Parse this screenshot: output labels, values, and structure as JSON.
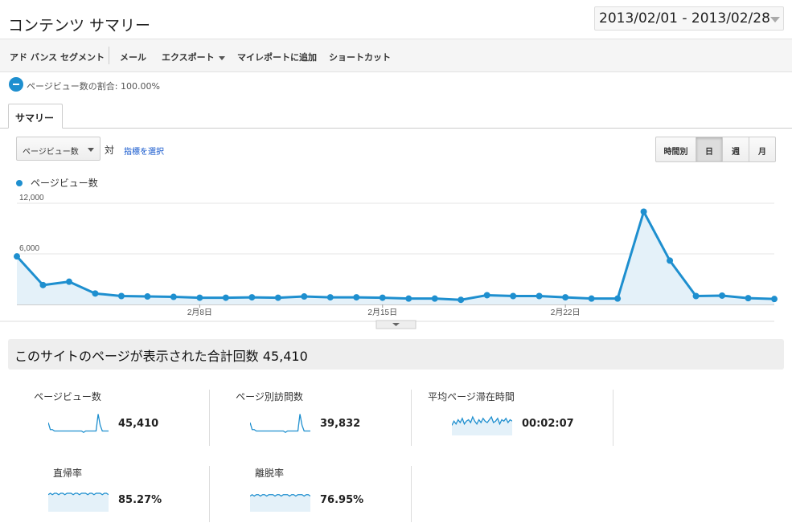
{
  "page": {
    "title": "コンテンツ サマリー"
  },
  "date_range": {
    "label": "2013/02/01 - 2013/02/28"
  },
  "toolbar": {
    "advanced_segments": "アド バンス セグメント",
    "email": "メール",
    "export": "エクスポート",
    "add_to_dashboard": "マイレポートに追加",
    "shortcut": "ショートカット"
  },
  "segment": {
    "label": "ページビュー数の割合: 100.00%"
  },
  "tabs": {
    "summary": "サマリー"
  },
  "controls": {
    "metric": "ページビュー数",
    "vs": "対",
    "choose_metric": "指標を選択",
    "periods": [
      "時間別",
      "日",
      "週",
      "月"
    ],
    "active_period": "日"
  },
  "chart_data": {
    "type": "area",
    "series": [
      {
        "name": "ページビュー数",
        "values": [
          5700,
          2300,
          2700,
          1300,
          1000,
          950,
          900,
          800,
          800,
          850,
          800,
          950,
          850,
          850,
          800,
          700,
          700,
          550,
          1100,
          1000,
          1000,
          850,
          700,
          700,
          11000,
          5200,
          1000,
          1050,
          750,
          650
        ]
      }
    ],
    "ylim": [
      0,
      12000
    ],
    "y_ticks": [
      "12,000",
      "6,000"
    ],
    "x_ticks": [
      {
        "index": 7,
        "label": "2月8日"
      },
      {
        "index": 14,
        "label": "2月15日"
      },
      {
        "index": 21,
        "label": "2月22日"
      }
    ],
    "grid": true,
    "color": "#1e8fcf",
    "fill": "#e4f1f9"
  },
  "summary": {
    "total_label": "このサイトのページが表示された合計回数 45,410"
  },
  "metrics": [
    {
      "title": "ページビュー数",
      "value": "45,410",
      "spark": [
        8,
        3,
        3,
        2,
        2,
        2,
        2,
        2,
        2,
        2,
        2,
        2,
        2,
        2,
        2,
        2,
        2,
        1,
        2,
        2,
        2,
        2,
        2,
        2,
        14,
        6,
        2,
        2,
        2,
        2
      ],
      "fill": false
    },
    {
      "title": "ページ別訪問数",
      "value": "39,832",
      "spark": [
        8,
        3,
        3,
        2,
        2,
        2,
        2,
        2,
        2,
        2,
        2,
        2,
        2,
        2,
        2,
        2,
        2,
        1,
        2,
        2,
        2,
        2,
        2,
        2,
        14,
        6,
        2,
        2,
        2,
        2
      ],
      "fill": false
    },
    {
      "title": "平均ページ滞在時間",
      "value": "00:02:07",
      "spark": [
        6,
        9,
        7,
        10,
        8,
        11,
        7,
        9,
        10,
        8,
        12,
        9,
        7,
        10,
        8,
        11,
        9,
        8,
        10,
        12,
        8,
        9,
        11,
        7,
        10,
        9,
        11,
        8,
        10,
        9
      ],
      "fill": true
    },
    {
      "title": "直帰率",
      "value": "85.27%",
      "spark": [
        11,
        12,
        11,
        12,
        12,
        11,
        12,
        12,
        11,
        12,
        12,
        12,
        11,
        12,
        12,
        11,
        12,
        12,
        12,
        11,
        12,
        12,
        11,
        12,
        12,
        12,
        11,
        12,
        12,
        11
      ],
      "fill": true
    },
    {
      "title": "離脱率",
      "value": "76.95%",
      "spark": [
        10,
        11,
        10,
        11,
        11,
        10,
        11,
        11,
        10,
        11,
        11,
        11,
        10,
        11,
        11,
        10,
        11,
        11,
        11,
        10,
        11,
        11,
        10,
        11,
        11,
        11,
        10,
        11,
        11,
        10
      ],
      "fill": true
    }
  ]
}
